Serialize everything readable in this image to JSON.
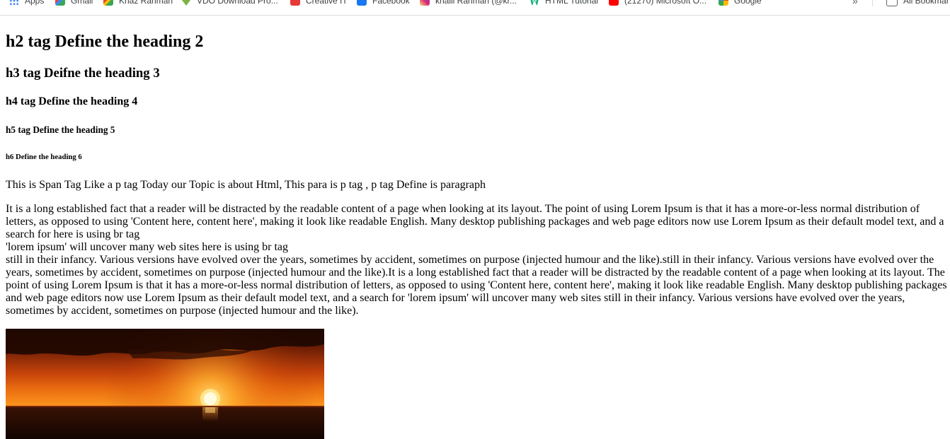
{
  "bookmarks_bar": {
    "items": [
      {
        "label": "Apps",
        "icon": "apps-grid-icon"
      },
      {
        "label": "Gmail",
        "icon": "gmail-icon"
      },
      {
        "label": "Khaz Rahman",
        "icon": "gmail-icon"
      },
      {
        "label": "VDO Download Pro...",
        "icon": "download-arrow-icon"
      },
      {
        "label": "Creative IT",
        "icon": "creative-it-icon"
      },
      {
        "label": "Facebook",
        "icon": "facebook-icon"
      },
      {
        "label": "khalil Rahman (@kr...",
        "icon": "instagram-icon"
      },
      {
        "label": "HTML Tutorial",
        "icon": "w3schools-icon"
      },
      {
        "label": "(21270) Microsoft O...",
        "icon": "youtube-icon"
      },
      {
        "label": "Google",
        "icon": "google-icon"
      }
    ],
    "overflow_label": "»",
    "all_bookmarks_label": "All Bookmar"
  },
  "page": {
    "h2": "h2 tag Define the heading 2",
    "h3": "h3 tag Deifne the heading 3",
    "h4": "h4 tag Define the heading 4",
    "h5": "h5 tag Define the heading 5",
    "h6": "h6 Define the heading 6",
    "span_paragraph": "This is Span Tag Like a p tag Today our Topic is about Html, This para is p tag , p tag Define is paragraph",
    "long_paragraph": {
      "line1": "It is a long established fact that a reader will be distracted by the readable content of a page when looking at its layout. The point of using Lorem Ipsum is that it has a more-or-less normal distribution of letters, as opposed to using 'Content here, content here', making it look like readable English. Many desktop publishing packages and web page editors now use Lorem Ipsum as their default model text, and a search for here is using br tag",
      "line2": "'lorem ipsum' will uncover many web sites here is using br tag",
      "line3": "still in their infancy. Various versions have evolved over the years, sometimes by accident, sometimes on purpose (injected humour and the like).still in their infancy. Various versions have evolved over the years, sometimes by accident, sometimes on purpose (injected humour and the like).It is a long established fact that a reader will be distracted by the readable content of a page when looking at its layout. The point of using Lorem Ipsum is that it has a more-or-less normal distribution of letters, as opposed to using 'Content here, content here', making it look like readable English. Many desktop publishing packages and web page editors now use Lorem Ipsum as their default model text, and a search for 'lorem ipsum' will uncover many web sites still in their infancy. Various versions have evolved over the years, sometimes by accident, sometimes on purpose (injected humour and the like)."
    },
    "image": {
      "subject": "sunset-over-sea"
    }
  },
  "colors": {
    "sky_top": "#2a0c02",
    "sky_mid": "#c2410a",
    "sky_glow": "#ff9a1f",
    "sun": "#fff6b0",
    "sea": "#1a0802"
  }
}
